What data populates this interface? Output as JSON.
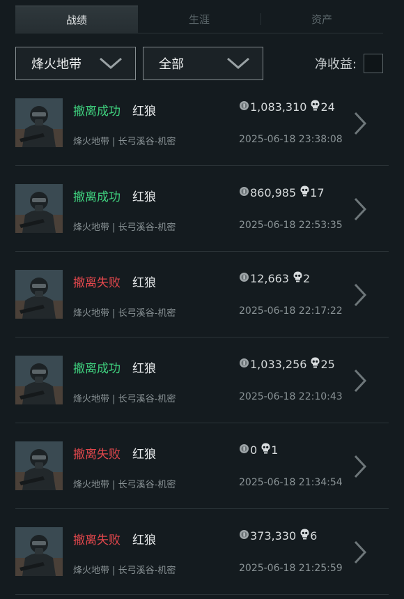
{
  "tabs": [
    {
      "label": "战绩",
      "active": true
    },
    {
      "label": "生涯",
      "active": false
    },
    {
      "label": "资产",
      "active": false
    }
  ],
  "filters": {
    "mode": "烽火地带",
    "scope": "全部",
    "net_label": "净收益:"
  },
  "records": [
    {
      "status": "撤离成功",
      "outcome": "success",
      "operator": "红狼",
      "mode": "烽火地带",
      "map": "长弓溪谷-机密",
      "value": "1,083,310",
      "kills": "24",
      "time": "2025-06-18 23:38:08"
    },
    {
      "status": "撤离成功",
      "outcome": "success",
      "operator": "红狼",
      "mode": "烽火地带",
      "map": "长弓溪谷-机密",
      "value": "860,985",
      "kills": "17",
      "time": "2025-06-18 22:53:35"
    },
    {
      "status": "撤离失败",
      "outcome": "fail",
      "operator": "红狼",
      "mode": "烽火地带",
      "map": "长弓溪谷-机密",
      "value": "12,663",
      "kills": "2",
      "time": "2025-06-18 22:17:22"
    },
    {
      "status": "撤离成功",
      "outcome": "success",
      "operator": "红狼",
      "mode": "烽火地带",
      "map": "长弓溪谷-机密",
      "value": "1,033,256",
      "kills": "25",
      "time": "2025-06-18 22:10:43"
    },
    {
      "status": "撤离失败",
      "outcome": "fail",
      "operator": "红狼",
      "mode": "烽火地带",
      "map": "长弓溪谷-机密",
      "value": "0",
      "kills": "1",
      "time": "2025-06-18 21:34:54"
    },
    {
      "status": "撤离失败",
      "outcome": "fail",
      "operator": "红狼",
      "mode": "烽火地带",
      "map": "长弓溪谷-机密",
      "value": "373,330",
      "kills": "6",
      "time": "2025-06-18 21:25:59"
    }
  ],
  "separator": " | ",
  "colors": {
    "success": "#3fd17e",
    "fail": "#e2474c",
    "background": "#141b1f"
  }
}
